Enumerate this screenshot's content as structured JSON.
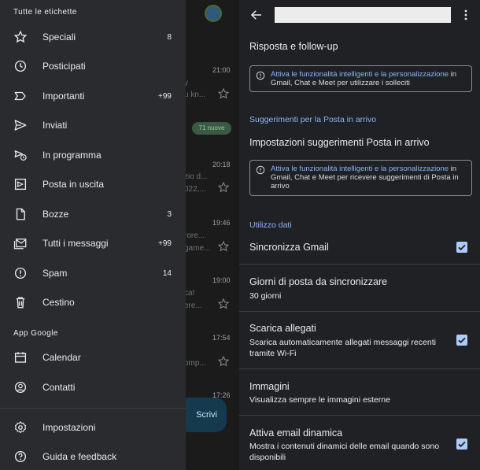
{
  "drawer": {
    "header_all": "Tutte le etichette",
    "items": [
      {
        "label": "Speciali",
        "count": "8",
        "icon": "star-icon"
      },
      {
        "label": "Posticipati",
        "count": "",
        "icon": "clock-icon"
      },
      {
        "label": "Importanti",
        "count": "+99",
        "icon": "important-icon"
      },
      {
        "label": "Inviati",
        "count": "",
        "icon": "send-icon"
      },
      {
        "label": "In programma",
        "count": "",
        "icon": "scheduled-icon"
      },
      {
        "label": "Posta in uscita",
        "count": "",
        "icon": "outbox-icon"
      },
      {
        "label": "Bozze",
        "count": "3",
        "icon": "draft-icon"
      },
      {
        "label": "Tutti i messaggi",
        "count": "+99",
        "icon": "all-mail-icon"
      },
      {
        "label": "Spam",
        "count": "14",
        "icon": "spam-icon"
      },
      {
        "label": "Cestino",
        "count": "",
        "icon": "trash-icon"
      }
    ],
    "header_apps": "App Google",
    "apps": [
      {
        "label": "Calendar",
        "icon": "calendar-icon"
      },
      {
        "label": "Contatti",
        "icon": "contacts-icon"
      }
    ],
    "bottom": [
      {
        "label": "Impostazioni",
        "icon": "gear-icon"
      },
      {
        "label": "Guida e feedback",
        "icon": "help-icon"
      }
    ]
  },
  "inbox": {
    "rows": [
      {
        "time": "21:00",
        "snip1": "y",
        "snip2": "u kn..."
      },
      {
        "time": "20:18",
        "snip1": "zio d...",
        "snip2": "022,..."
      },
      {
        "time": "19:46",
        "snip1": "rore...",
        "snip2": "game..."
      },
      {
        "time": "19:00",
        "snip1": "ca!",
        "snip2": "ere..."
      },
      {
        "time": "17:54",
        "snip1": "",
        "snip2": "omp..."
      },
      {
        "time": "17:26",
        "snip1": "",
        "snip2": ""
      }
    ],
    "badge": "71 nuove",
    "compose": "Scrivi"
  },
  "settings": {
    "sec1_title": "Risposta e follow-up",
    "info1_link": "Attiva le funzionalità intelligenti e la personalizzazione",
    "info1_rest": " in Gmail, Chat e Meet per utilizzare i solleciti",
    "section_suggestions": "Suggerimenti per la Posta in arrivo",
    "sugg_title": "Impostazioni suggerimenti Posta in arrivo",
    "info2_link": "Attiva le funzionalità intelligenti e la personalizzazione",
    "info2_rest": " in Gmail, Chat e Meet per ricevere suggerimenti di Posta in arrivo",
    "section_data": "Utilizzo dati",
    "sync_title": "Sincronizza Gmail",
    "days_title": "Giorni di posta da sincronizzare",
    "days_value": "30 giorni",
    "attach_title": "Scarica allegati",
    "attach_sub": "Scarica automaticamente allegati messaggi recenti tramite Wi-Fi",
    "images_title": "Immagini",
    "images_sub": "Visualizza sempre le immagini esterne",
    "dyn_title": "Attiva email dinamica",
    "dyn_sub": "Mostra i contenuti dinamici delle email quando sono disponibili",
    "sync_checked": true,
    "attach_checked": true,
    "dyn_checked": true,
    "accent": "#8ab4f8"
  }
}
